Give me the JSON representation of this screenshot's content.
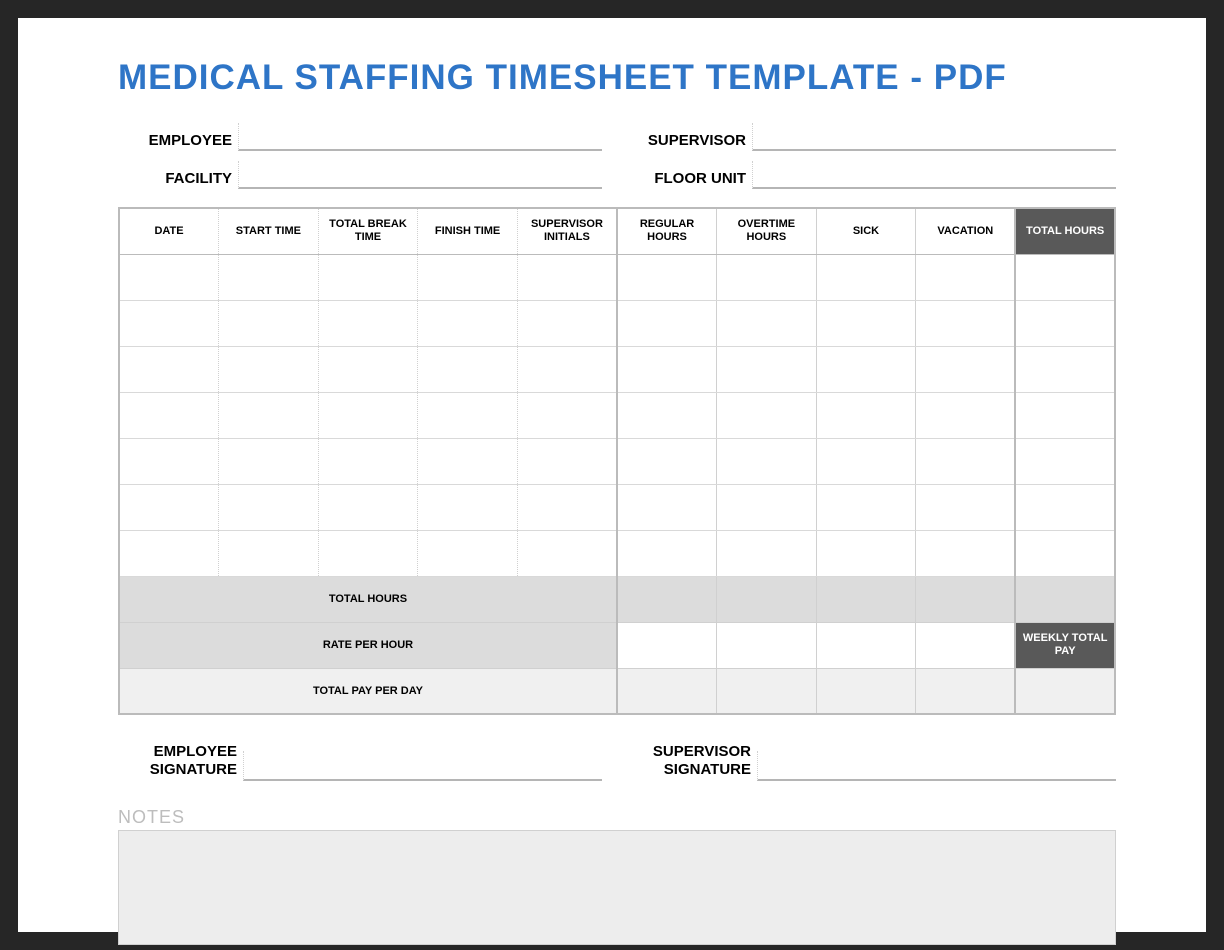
{
  "title": "MEDICAL STAFFING TIMESHEET TEMPLATE - PDF",
  "info": {
    "employee_label": "EMPLOYEE",
    "employee": "",
    "supervisor_label": "SUPERVISOR",
    "supervisor": "",
    "facility_label": "FACILITY",
    "facility": "",
    "floorunit_label": "FLOOR UNIT",
    "floorunit": ""
  },
  "columns": {
    "date": "DATE",
    "start": "START TIME",
    "break": "TOTAL BREAK TIME",
    "finish": "FINISH TIME",
    "supinit": "SUPERVISOR INITIALS",
    "regular": "REGULAR HOURS",
    "overtime": "OVERTIME HOURS",
    "sick": "SICK",
    "vacation": "VACATION",
    "total": "TOTAL HOURS"
  },
  "rows": [
    {
      "date": "",
      "start": "",
      "break": "",
      "finish": "",
      "supinit": "",
      "regular": "",
      "overtime": "",
      "sick": "",
      "vacation": "",
      "total": ""
    },
    {
      "date": "",
      "start": "",
      "break": "",
      "finish": "",
      "supinit": "",
      "regular": "",
      "overtime": "",
      "sick": "",
      "vacation": "",
      "total": ""
    },
    {
      "date": "",
      "start": "",
      "break": "",
      "finish": "",
      "supinit": "",
      "regular": "",
      "overtime": "",
      "sick": "",
      "vacation": "",
      "total": ""
    },
    {
      "date": "",
      "start": "",
      "break": "",
      "finish": "",
      "supinit": "",
      "regular": "",
      "overtime": "",
      "sick": "",
      "vacation": "",
      "total": ""
    },
    {
      "date": "",
      "start": "",
      "break": "",
      "finish": "",
      "supinit": "",
      "regular": "",
      "overtime": "",
      "sick": "",
      "vacation": "",
      "total": ""
    },
    {
      "date": "",
      "start": "",
      "break": "",
      "finish": "",
      "supinit": "",
      "regular": "",
      "overtime": "",
      "sick": "",
      "vacation": "",
      "total": ""
    },
    {
      "date": "",
      "start": "",
      "break": "",
      "finish": "",
      "supinit": "",
      "regular": "",
      "overtime": "",
      "sick": "",
      "vacation": "",
      "total": ""
    }
  ],
  "summary": {
    "total_hours_label": "TOTAL HOURS",
    "rate_label": "RATE PER HOUR",
    "pay_per_day_label": "TOTAL PAY PER DAY",
    "weekly_pay_label": "WEEKLY TOTAL PAY",
    "total_hours": {
      "regular": "",
      "overtime": "",
      "sick": "",
      "vacation": "",
      "total": ""
    },
    "rate": {
      "regular": "",
      "overtime": "",
      "sick": "",
      "vacation": ""
    },
    "pay": {
      "regular": "",
      "overtime": "",
      "sick": "",
      "vacation": "",
      "weekly": ""
    }
  },
  "signatures": {
    "employee_label": "EMPLOYEE SIGNATURE",
    "employee": "",
    "supervisor_label": "SUPERVISOR SIGNATURE",
    "supervisor": ""
  },
  "notes": {
    "label": "NOTES",
    "value": ""
  }
}
